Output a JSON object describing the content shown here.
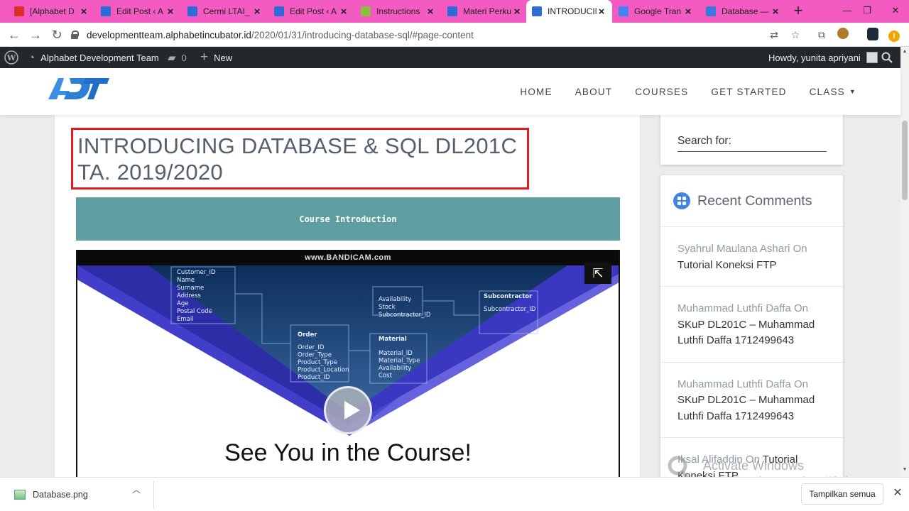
{
  "browser": {
    "tabs": [
      {
        "title": "[Alphabet D",
        "favicon": "gmail-icon",
        "color": "#d93025"
      },
      {
        "title": "Edit Post ‹ A",
        "favicon": "adt-icon",
        "color": "#2f6bd6"
      },
      {
        "title": "Cermi LTAI_",
        "favicon": "adt-icon",
        "color": "#2f6bd6"
      },
      {
        "title": "Edit Post ‹ A",
        "favicon": "adt-icon",
        "color": "#2f6bd6"
      },
      {
        "title": "Instructions",
        "favicon": "doc-icon",
        "color": "#8dbf3c"
      },
      {
        "title": "Materi Perku",
        "favicon": "adt-icon",
        "color": "#2f6bd6"
      },
      {
        "title": "INTRODUCIN",
        "favicon": "adt-icon",
        "color": "#2f6bd6"
      },
      {
        "title": "Google Tran",
        "favicon": "translate-icon",
        "color": "#4285f4"
      },
      {
        "title": "Database —",
        "favicon": "p-icon",
        "color": "#3b7bdc"
      }
    ],
    "active_tab_index": 6,
    "url_host": "developmentteam.alphabetincubator.id",
    "url_path": "/2020/01/31/introducing-database-sql/#page-content"
  },
  "adminbar": {
    "site_name": "Alphabet Development Team",
    "comments_count": "0",
    "new_label": "New",
    "howdy": "Howdy, yunita apriyani"
  },
  "nav": {
    "items": [
      "HOME",
      "ABOUT",
      "COURSES",
      "GET STARTED",
      "CLASS"
    ]
  },
  "post": {
    "title": "INTRODUCING DATABASE & SQL DL201C TA. 2019/2020",
    "course_intro": "Course Introduction",
    "video": {
      "watermark": "www.BANDICAM.com",
      "caption": "See You in the Course!",
      "diagram_entities": {
        "customer": [
          "Customer_ID",
          "Name",
          "Surname",
          "Address",
          "Age",
          "Postal Code",
          "Email"
        ],
        "order_title": "Order",
        "order": [
          "Order_ID",
          "Order_Type",
          "Product_Type",
          "Product_Location",
          "Product_ID"
        ],
        "material_title": "Material",
        "material": [
          "Material_ID",
          "Material_Type",
          "Availability",
          "Cost"
        ],
        "subcontractor_title": "Subcontractor",
        "subcontractor": [
          "Subcontractor_ID"
        ],
        "mid": [
          "Availability",
          "Stock",
          "Subcontractor_ID"
        ]
      }
    }
  },
  "sidebar": {
    "search_label": "Search for:",
    "recent_comments_title": "Recent Comments",
    "comments": [
      {
        "author": "Syahrul Maulana Ashari",
        "on": "On",
        "post": "Tutorial Koneksi FTP"
      },
      {
        "author": "Muhammad Luthfi Daffa",
        "on": "On",
        "post": "SKuP DL201C – Muhammad Luthfi Daffa 1712499643"
      },
      {
        "author": "Muhammad Luthfi Daffa",
        "on": "On",
        "post": "SKuP DL201C – Muhammad Luthfi Daffa 1712499643"
      },
      {
        "author": "Iksal Alifaddin",
        "on": "On",
        "post": "Tutorial Koneksi FTP"
      }
    ]
  },
  "watermark": {
    "line1": "Activate Windows",
    "line2": "Go to PC settings to activate Windows."
  },
  "downloads": {
    "file_name": "Database.png",
    "show_all": "Tampilkan semua"
  },
  "colors": {
    "tabstrip": "#f35ac2",
    "title_border": "#e31b23",
    "course_bar": "#5f9ea0",
    "widget_icon": "#3d86e6"
  }
}
